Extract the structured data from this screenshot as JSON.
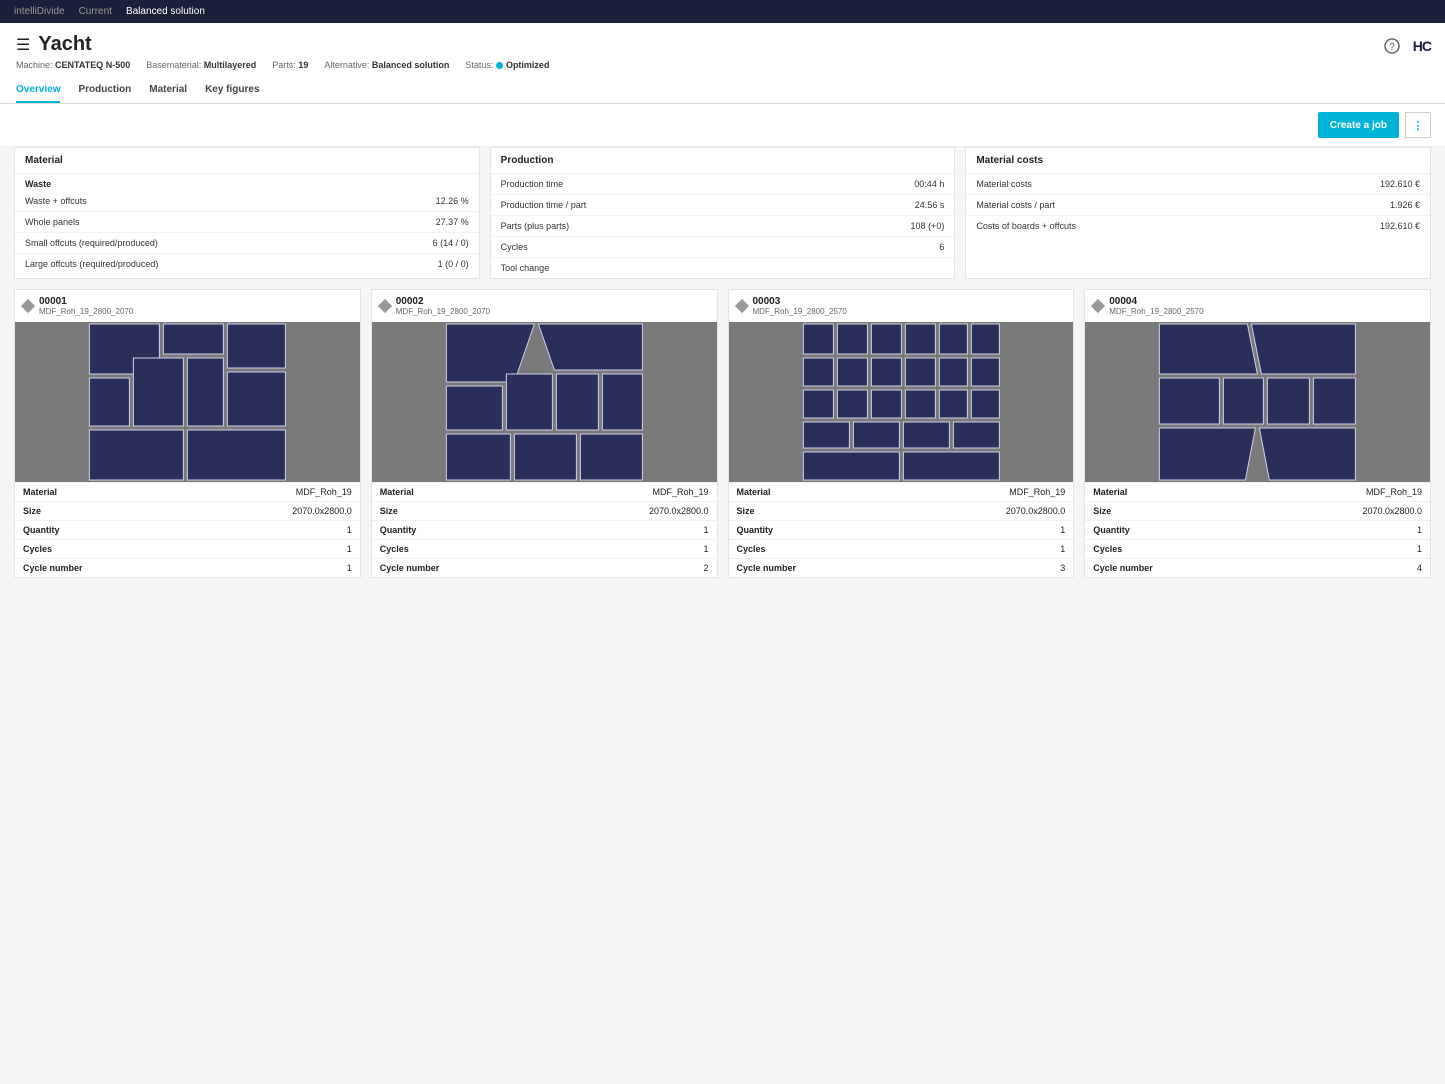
{
  "topbar": {
    "app": "intelliDivide",
    "breadcrumb1": "Current",
    "breadcrumb2": "Balanced solution"
  },
  "header": {
    "title": "Yacht",
    "meta": {
      "machine_label": "Machine:",
      "machine_value": "CENTATEQ N-500",
      "basematerial_label": "Basematerial:",
      "basematerial_value": "Multilayered",
      "parts_label": "Parts:",
      "parts_value": "19",
      "alternative_label": "Alternative:",
      "alternative_value": "Balanced solution",
      "status_label": "Status:",
      "status_value": "Optimized"
    },
    "tabs": [
      "Overview",
      "Production",
      "Material",
      "Key figures"
    ],
    "active_tab": 0,
    "logo": "HC"
  },
  "actions": {
    "primary": "Create a job"
  },
  "material_panel": {
    "title": "Material",
    "subhead": "Waste",
    "rows": [
      {
        "k": "Waste + offcuts",
        "v": "12.26 %"
      },
      {
        "k": "Whole panels",
        "v": "27.37 %"
      },
      {
        "k": "Small offcuts (required/produced)",
        "v": "6 (14 / 0)"
      },
      {
        "k": "Large offcuts (required/produced)",
        "v": "1 (0 / 0)"
      }
    ]
  },
  "production_panel": {
    "title": "Production",
    "rows": [
      {
        "k": "Production time",
        "v": "00:44 h"
      },
      {
        "k": "Production time / part",
        "v": "24.56 s"
      },
      {
        "k": "Parts (plus parts)",
        "v": "108 (+0)"
      },
      {
        "k": "Cycles",
        "v": "6"
      },
      {
        "k": "Tool change",
        "v": ""
      }
    ]
  },
  "costs_panel": {
    "title": "Material costs",
    "rows": [
      {
        "k": "Material costs",
        "v": "192.610 €"
      },
      {
        "k": "Material costs / part",
        "v": "1.926 €"
      },
      {
        "k": "Costs of boards + offcuts",
        "v": "192.610 €"
      }
    ]
  },
  "boards": [
    {
      "id": "00001",
      "mat": "MDF_Roh_19_2800_2070",
      "props": {
        "material": "MDF_Roh_19",
        "size": "2070.0x2800.0",
        "quantity": "1",
        "cycles": "1",
        "cycle_number": "1"
      }
    },
    {
      "id": "00002",
      "mat": "MDF_Roh_19_2800_2070",
      "props": {
        "material": "MDF_Roh_19",
        "size": "2070.0x2800.0",
        "quantity": "1",
        "cycles": "1",
        "cycle_number": "2"
      }
    },
    {
      "id": "00003",
      "mat": "MDF_Roh_19_2800_2570",
      "props": {
        "material": "MDF_Roh_19",
        "size": "2070.0x2800.0",
        "quantity": "1",
        "cycles": "1",
        "cycle_number": "3"
      }
    },
    {
      "id": "00004",
      "mat": "MDF_Roh_19_2800_2570",
      "props": {
        "material": "MDF_Roh_19",
        "size": "2070.0x2800.0",
        "quantity": "1",
        "cycles": "1",
        "cycle_number": "4"
      }
    }
  ],
  "labels": {
    "material": "Material",
    "size": "Size",
    "quantity": "Quantity",
    "cycles": "Cycles",
    "cycle_number": "Cycle number"
  }
}
